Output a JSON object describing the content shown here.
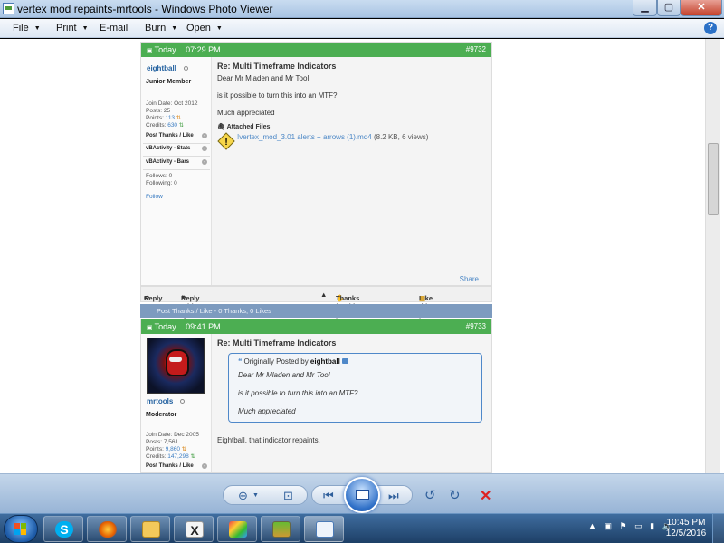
{
  "window": {
    "title": "vertex mod repaints-mrtools - Windows Photo Viewer"
  },
  "menu": {
    "file": "File",
    "print": "Print",
    "email": "E-mail",
    "burn": "Burn",
    "open": "Open",
    "help": "?"
  },
  "post1": {
    "date": "Today",
    "time": "07:29 PM",
    "number": "#9732",
    "username": "eightball",
    "user_title": "Junior Member",
    "join_date": "Join Date:  Oct 2012",
    "posts": "Posts:  25",
    "points_label": "Points: ",
    "points_value": "113",
    "credits_label": "Credits: ",
    "credits_value": "630",
    "post_thanks": "Post Thanks / Like",
    "stats_activity": "vBActivity - Stats",
    "bars_activity": "vBActivity - Bars",
    "follows": "Follows:  0",
    "following": "Following:  0",
    "follow_link": "Follow",
    "title": "Re: Multi Timeframe Indicators",
    "line1": "Dear Mr Mladen and Mr Tool",
    "line2": "is it possible to turn this into an MTF?",
    "line3": "Much appreciated",
    "attached_files": "Attached Files",
    "attachment_name": "!vertex_mod_3.01 alerts + arrows (1).mq4",
    "attachment_info": " (8.2 KB, 6 views)",
    "share": "Share",
    "reply": "Reply",
    "reply_quote": "Reply With Quote",
    "thank": "Thanks for this post",
    "like": "Like this post",
    "thanks_summary": "Post Thanks / Like - 0 Thanks, 0 Likes"
  },
  "post2": {
    "date": "Today",
    "time": "09:41 PM",
    "number": "#9733",
    "username": "mrtools",
    "user_title": "Moderator",
    "join_date": "Join Date:  Dec 2005",
    "posts": "Posts:  7,561",
    "points_label": "Points: ",
    "points_value": "9,860",
    "credits_label": "Credits: ",
    "credits_value": "147,298",
    "post_thanks": "Post Thanks / Like",
    "title": "Re: Multi Timeframe Indicators",
    "quote_prefix": "Originally Posted by ",
    "quote_author": "eightball",
    "quote_line1": "Dear Mr Mladen and Mr Tool",
    "quote_line2": "is it possible to turn this into an MTF?",
    "quote_line3": "Much appreciated",
    "reply_text": "Eightball, that indicator repaints."
  },
  "taskbar": {
    "time": "10:45 PM",
    "date": "12/5/2016",
    "apps": [
      "skype-icon",
      "firefox-icon",
      "folder-icon",
      "metatrader-icon",
      "paint-icon",
      "winrar-icon",
      "photo-viewer-icon"
    ]
  },
  "colors": {
    "post_header": "#4cae52",
    "link": "#4b87c6",
    "thanks_bar": "#7d9bbf"
  }
}
